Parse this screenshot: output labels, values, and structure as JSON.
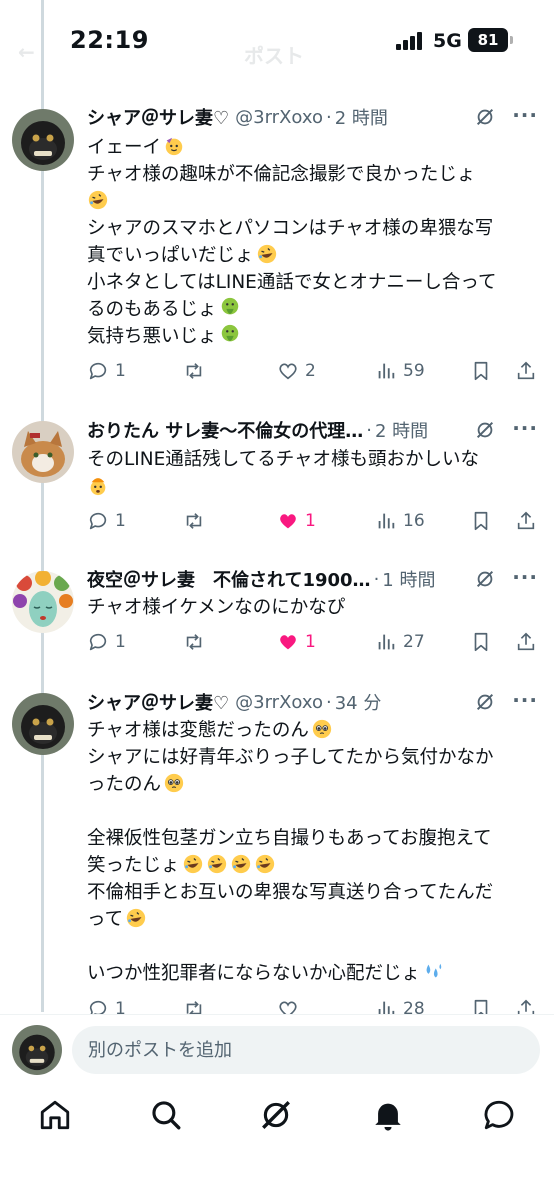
{
  "status_bar": {
    "time": "22:19",
    "network": "5G",
    "battery": "81"
  },
  "top_bar": {
    "title": "ポスト"
  },
  "posts": [
    {
      "name": "シャア＠サレ妻♡",
      "handle": "@3rrXoxo",
      "separator": "·",
      "ago": "2 時間",
      "lines": [
        "イェーイ",
        "チャオ様の趣味が不倫記念撮影で良かったじょ",
        "",
        "シャアのスマホとパソコンはチャオ様の卑猥な写",
        "真でいっぱいだじょ",
        "小ネタとしてはLINE通話で女とオナニーし合って",
        "るのもあるじょ",
        "気持ち悪いじょ"
      ],
      "replies": "1",
      "reposts": "",
      "likes": "2",
      "views": "59",
      "liked": false
    },
    {
      "name": "おりたん サレ妻〜不倫女の代理…",
      "handle": "",
      "separator": "·",
      "ago": "2 時間",
      "lines": [
        "そのLINE通話残してるチャオ様も頭おかしいな",
        ""
      ],
      "replies": "1",
      "reposts": "",
      "likes": "1",
      "views": "16",
      "liked": true
    },
    {
      "name": "夜空＠サレ妻　不倫されて1900…",
      "handle": "",
      "separator": "·",
      "ago": "1 時間",
      "lines": [
        "チャオ様イケメンなのにかなぴ"
      ],
      "replies": "1",
      "reposts": "",
      "likes": "1",
      "views": "27",
      "liked": true
    },
    {
      "name": "シャア＠サレ妻♡",
      "handle": "@3rrXoxo",
      "separator": "·",
      "ago": "34 分",
      "lines": [
        "チャオ様は変態だったのん",
        "シャアには好青年ぶりっ子してたから気付かなか",
        "ったのん",
        "",
        "全裸仮性包茎ガン立ち自撮りもあってお腹抱えて",
        "笑ったじょ",
        "不倫相手とお互いの卑猥な写真送り合ってたんだ",
        "って",
        "",
        "いつか性犯罪者にならないか心配だじょ"
      ],
      "replies": "1",
      "reposts": "",
      "likes": "",
      "views": "28",
      "liked": false
    }
  ],
  "composer": {
    "placeholder": "別のポストを追加"
  },
  "nav": {
    "items": [
      "home-icon",
      "search-icon",
      "grok-icon",
      "notifications-icon",
      "messages-icon"
    ]
  },
  "colors": {
    "text": "#0f1419",
    "muted": "#536471",
    "like": "#f91880",
    "thread_line": "#cfd9de"
  }
}
